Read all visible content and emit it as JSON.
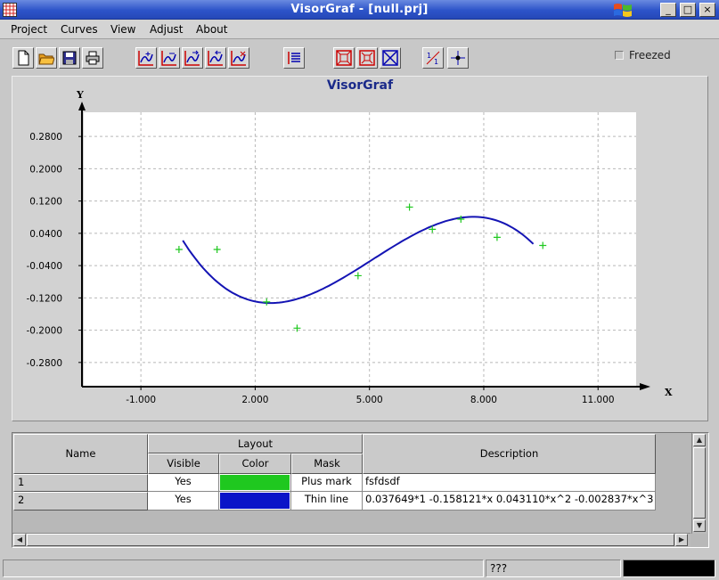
{
  "window": {
    "title": "VisorGraf - [null.prj]",
    "minimize": "_",
    "maximize": "□",
    "close": "×"
  },
  "menu": [
    "Project",
    "Curves",
    "View",
    "Adjust",
    "About"
  ],
  "toolbar": {
    "groups": [
      [
        "new-file-icon",
        "open-folder-icon",
        "save-icon",
        "print-icon"
      ],
      [
        "add-curve-icon",
        "edit-curve-icon",
        "curve-forward-icon",
        "curve-back-icon",
        "delete-curve-icon"
      ],
      [
        "curve-list-icon"
      ],
      [
        "zoom-fit-icon",
        "zoom-out-icon",
        "zoom-reset-icon"
      ],
      [
        "scale-1-1-icon",
        "crosshair-icon"
      ]
    ],
    "freeze_label": "Freezed",
    "freeze_checked": false
  },
  "chart_data": {
    "type": "scatter",
    "title": "VisorGraf",
    "xlabel": "X",
    "ylabel": "Y",
    "xlim": [
      -2.5,
      12.0
    ],
    "ylim": [
      -0.34,
      0.34
    ],
    "xticks": [
      -1.0,
      2.0,
      5.0,
      8.0,
      11.0
    ],
    "xtick_labels": [
      "-1.000",
      "2.000",
      "5.000",
      "8.000",
      "11.000"
    ],
    "yticks": [
      -0.28,
      -0.2,
      -0.12,
      -0.04,
      0.04,
      0.12,
      0.2,
      0.28
    ],
    "ytick_labels": [
      "-0.2800",
      "-0.2000",
      "-0.1200",
      "-0.0400",
      "0.0400",
      "0.1200",
      "0.2000",
      "0.2800"
    ],
    "grid": true,
    "series": [
      {
        "name": "fsfdsdf",
        "kind": "points",
        "color": "#1fc81f",
        "x": [
          0.0,
          1.0,
          2.3,
          3.1,
          4.7,
          6.05,
          6.65,
          7.4,
          8.35,
          9.55
        ],
        "y": [
          -0.0,
          -0.0,
          -0.13,
          -0.195,
          -0.065,
          0.105,
          0.05,
          0.075,
          0.03,
          0.01
        ]
      },
      {
        "name": "0.037649*1  -0.158121*x  0.043110*x^2  -0.002837*x^3",
        "kind": "line",
        "color": "#1414b4",
        "coefficients": [
          0.037649,
          -0.158121,
          0.04311,
          -0.002837
        ],
        "x_range": [
          0.1,
          9.3
        ]
      }
    ]
  },
  "table": {
    "headers": {
      "name": "Name",
      "layout": "Layout",
      "visible": "Visible",
      "color": "Color",
      "mask": "Mask",
      "description": "Description"
    },
    "rows": [
      {
        "id": "1",
        "visible": "Yes",
        "color": "#1fc81f",
        "mask": "Plus mark",
        "description": "fsfdsdf"
      },
      {
        "id": "2",
        "visible": "Yes",
        "color": "#0a14c8",
        "mask": "Thin line",
        "description": "0.037649*1  -0.158121*x  0.043110*x^2  -0.002837*x^3"
      }
    ]
  },
  "status": {
    "left": "",
    "middle": "???",
    "right": ""
  }
}
